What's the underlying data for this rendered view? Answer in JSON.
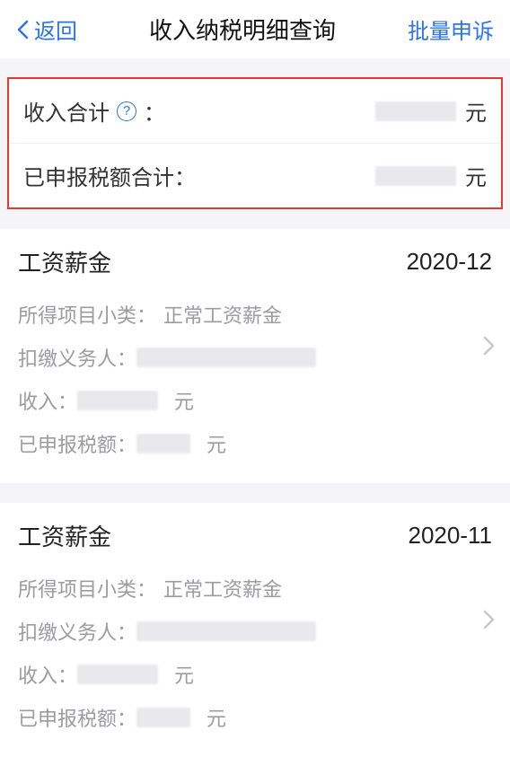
{
  "header": {
    "back_label": "返回",
    "title": "收入纳税明细查询",
    "action_label": "批量申诉"
  },
  "summary": {
    "income_label": "收入合计",
    "colon": "：",
    "unit": "元",
    "declared_label": "已申报税额合计："
  },
  "cards": [
    {
      "title": "工资薪金",
      "date": "2020-12",
      "subtype_label": "所得项目小类：",
      "subtype_value": "正常工资薪金",
      "agent_label": "扣缴义务人：",
      "income_label": "收入：",
      "income_unit": "元",
      "declared_label": "已申报税额：",
      "declared_unit": "元"
    },
    {
      "title": "工资薪金",
      "date": "2020-11",
      "subtype_label": "所得项目小类：",
      "subtype_value": "正常工资薪金",
      "agent_label": "扣缴义务人：",
      "income_label": "收入：",
      "income_unit": "元",
      "declared_label": "已申报税额：",
      "declared_unit": "元"
    }
  ]
}
